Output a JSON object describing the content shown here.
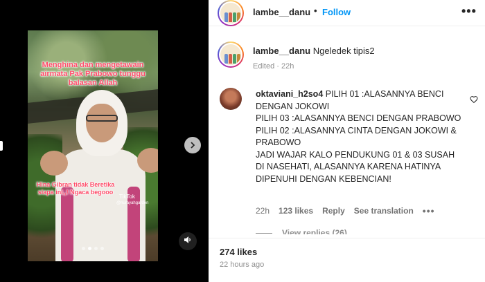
{
  "media": {
    "overlay_top": "Menghina dan mengetawain airmata Pak Prabowo tunggu balasan Allah",
    "overlay_mid": "Hina Gibran tidak Beretika siapa ini,,! Ngaca begooo",
    "watermark_brand": "TikTok",
    "watermark_user": "@nurayahgarden",
    "carousel_count": 4,
    "carousel_active": 1
  },
  "header": {
    "username": "lambe__danu",
    "separator": "•",
    "follow_label": "Follow",
    "more_label": "•••"
  },
  "caption": {
    "username": "lambe__danu",
    "text": "Ngeledek tipis2",
    "edited": "Edited · 22h"
  },
  "comment": {
    "username": "oktaviani_h2so4",
    "lines": [
      "PILIH 01 :ALASANNYA BENCI DENGAN JOKOWI",
      "PILIH 03 :ALASANNYA BENCI DENGAN PRABOWO",
      "PILIH 02 :ALASANNYA CINTA DENGAN JOKOWI & PRABOWO",
      "JADI WAJAR KALO PENDUKUNG 01 & 03 SUSAH DI NASEHATI, ALASANNYA KARENA HATINYA DIPENUHI DENGAN KEBENCIAN!"
    ],
    "time": "22h",
    "likes": "123 likes",
    "reply_label": "Reply",
    "translation_label": "See translation",
    "more_label": "•••",
    "view_replies": "View replies (26)"
  },
  "post": {
    "likes": "274 likes",
    "time_ago": "22 hours ago"
  },
  "colors": {
    "accent": "#0095f6",
    "overlay_text": "#ff4d6a",
    "scarf": "#c2447a"
  },
  "icons": {
    "next": "chevron-right-icon",
    "mute": "speaker-icon",
    "like": "heart-icon"
  }
}
